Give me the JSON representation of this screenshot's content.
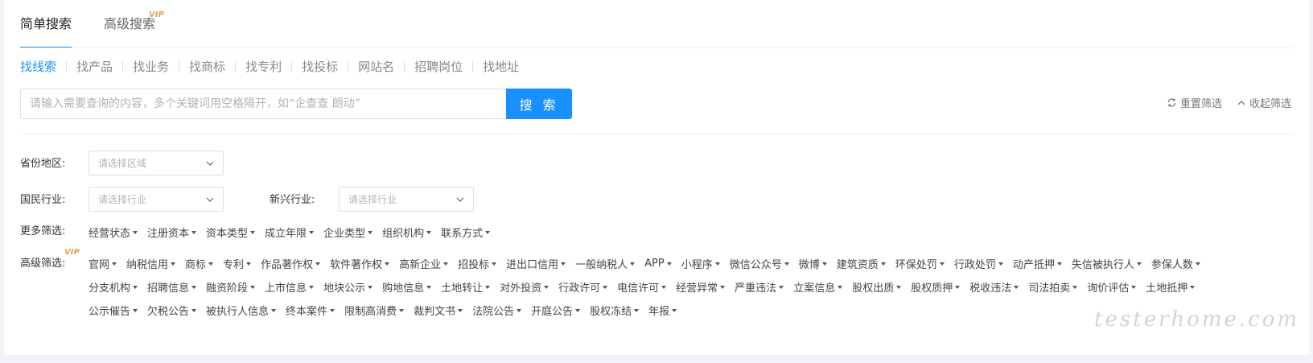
{
  "top_tabs": {
    "simple": "简单搜索",
    "advanced": "高级搜索",
    "vip_badge": "VIP"
  },
  "sub_tabs": [
    "找线索",
    "找产品",
    "找业务",
    "找商标",
    "找专利",
    "找投标",
    "网站名",
    "招聘岗位",
    "找地址"
  ],
  "search": {
    "placeholder": "请输入需要查询的内容，多个关键词用空格隔开，如“企查查 朗动”",
    "value": "",
    "button_label": "搜 索"
  },
  "actions": {
    "reset": "重置筛选",
    "collapse": "收起筛选"
  },
  "filters": {
    "province_label": "省份地区:",
    "province_placeholder": "请选择区域",
    "industry_label": "国民行业:",
    "industry_placeholder": "请选择行业",
    "emerging_label": "新兴行业:",
    "emerging_placeholder": "请选择行业",
    "more_label": "更多筛选:",
    "more_options": [
      "经营状态",
      "注册资本",
      "资本类型",
      "成立年限",
      "企业类型",
      "组织机构",
      "联系方式"
    ],
    "advanced_label": "高级筛选:",
    "advanced_vip": "VIP",
    "advanced_options": [
      "官网",
      "纳税信用",
      "商标",
      "专利",
      "作品著作权",
      "软件著作权",
      "高新企业",
      "招投标",
      "进出口信用",
      "一般纳税人",
      "APP",
      "小程序",
      "微信公众号",
      "微博",
      "建筑资质",
      "环保处罚",
      "行政处罚",
      "动产抵押",
      "失信被执行人",
      "参保人数",
      "分支机构",
      "招聘信息",
      "融资阶段",
      "上市信息",
      "地块公示",
      "购地信息",
      "土地转让",
      "对外投资",
      "行政许可",
      "电信许可",
      "经营异常",
      "严重违法",
      "立案信息",
      "股权出质",
      "股权质押",
      "税收违法",
      "司法拍卖",
      "询价评估",
      "土地抵押",
      "公示催告",
      "欠税公告",
      "被执行人信息",
      "终本案件",
      "限制高消费",
      "裁判文书",
      "法院公告",
      "开庭公告",
      "股权冻结",
      "年报"
    ]
  },
  "watermark": "testerhome.com"
}
